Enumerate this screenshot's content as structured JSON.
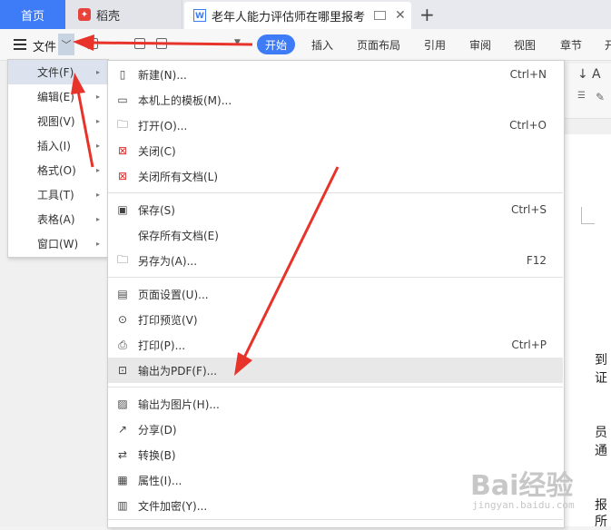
{
  "tabs": {
    "home": "首页",
    "daoke": "稻壳",
    "doc_title": "老年人能力评估师在哪里报考",
    "doc_icon_letter": "W"
  },
  "toolbar": {
    "file_label": "文件",
    "ribbon_tabs": [
      "开始",
      "插入",
      "页面布局",
      "引用",
      "审阅",
      "视图",
      "章节",
      "开"
    ]
  },
  "side_menu": [
    {
      "label": "文件(F)",
      "active": true
    },
    {
      "label": "编辑(E)"
    },
    {
      "label": "视图(V)"
    },
    {
      "label": "插入(I)"
    },
    {
      "label": "格式(O)"
    },
    {
      "label": "工具(T)"
    },
    {
      "label": "表格(A)"
    },
    {
      "label": "窗口(W)"
    }
  ],
  "file_menu": [
    {
      "label": "新建(N)...",
      "shortcut": "Ctrl+N",
      "icon": "new-doc-icon"
    },
    {
      "label": "本机上的模板(M)...",
      "shortcut": "",
      "icon": "template-icon"
    },
    {
      "label": "打开(O)...",
      "shortcut": "Ctrl+O",
      "icon": "open-folder-icon"
    },
    {
      "label": "关闭(C)",
      "shortcut": "",
      "icon": "close-doc-icon"
    },
    {
      "label": "关闭所有文档(L)",
      "shortcut": "",
      "icon": "close-all-icon"
    },
    {
      "label": "保存(S)",
      "shortcut": "Ctrl+S",
      "icon": "save-icon"
    },
    {
      "label": "保存所有文档(E)",
      "shortcut": "",
      "icon": ""
    },
    {
      "label": "另存为(A)...",
      "shortcut": "F12",
      "icon": "save-as-icon"
    },
    {
      "label": "页面设置(U)...",
      "shortcut": "",
      "icon": "page-setup-icon"
    },
    {
      "label": "打印预览(V)",
      "shortcut": "",
      "icon": "print-preview-icon"
    },
    {
      "label": "打印(P)...",
      "shortcut": "Ctrl+P",
      "icon": "print-icon"
    },
    {
      "label": "输出为PDF(F)...",
      "shortcut": "",
      "icon": "pdf-export-icon",
      "highlight": true
    },
    {
      "label": "输出为图片(H)...",
      "shortcut": "",
      "icon": "image-export-icon"
    },
    {
      "label": "分享(D)",
      "shortcut": "",
      "icon": "share-icon"
    },
    {
      "label": "转换(B)",
      "shortcut": "",
      "icon": "convert-icon"
    },
    {
      "label": "属性(I)...",
      "shortcut": "",
      "icon": "properties-icon"
    },
    {
      "label": "文件加密(Y)...",
      "shortcut": "",
      "icon": "encrypt-icon"
    }
  ],
  "doc_text": [
    "到",
    "证",
    "员",
    "通",
    "报",
    "所"
  ],
  "watermark": {
    "main": "Bai经验",
    "sub": "jingyan.baidu.com"
  },
  "colors": {
    "accent": "#3e7bf6",
    "arrow": "#e8332a"
  }
}
